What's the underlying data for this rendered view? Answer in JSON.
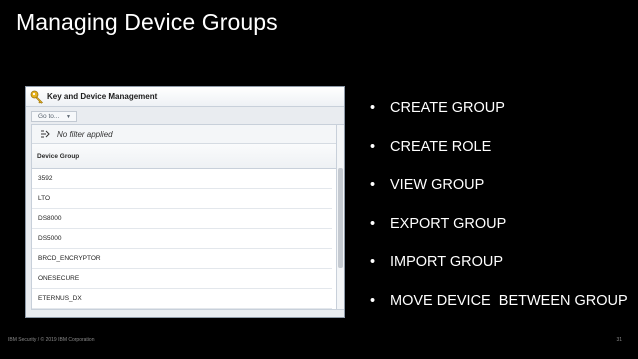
{
  "slide": {
    "title": "Managing Device Groups"
  },
  "panel": {
    "title": "Key and Device Management",
    "goto_label": "Go to...",
    "goto_arrow": "▼",
    "filter_text": "No filter applied",
    "column_header": "Device Group",
    "rows": [
      "3592",
      "LTO",
      "DS8000",
      "DS5000",
      "BRCD_ENCRYPTOR",
      "ONESECURE",
      "ETERNUS_DX"
    ]
  },
  "bullets": [
    "CREATE GROUP",
    "CREATE ROLE",
    "VIEW GROUP",
    "EXPORT GROUP",
    "IMPORT GROUP",
    "MOVE DEVICE  BETWEEN GROUP"
  ],
  "bullet_symbol": "•",
  "footer": {
    "copyright": "IBM Security / © 2019 IBM Corporation",
    "page_number": "31"
  },
  "colors": {
    "background": "#000000",
    "text": "#ffffff",
    "panel_border": "#8e9aa8"
  },
  "icons": {
    "panel_icon": "key-icon",
    "filter_icon": "filter-icon"
  }
}
